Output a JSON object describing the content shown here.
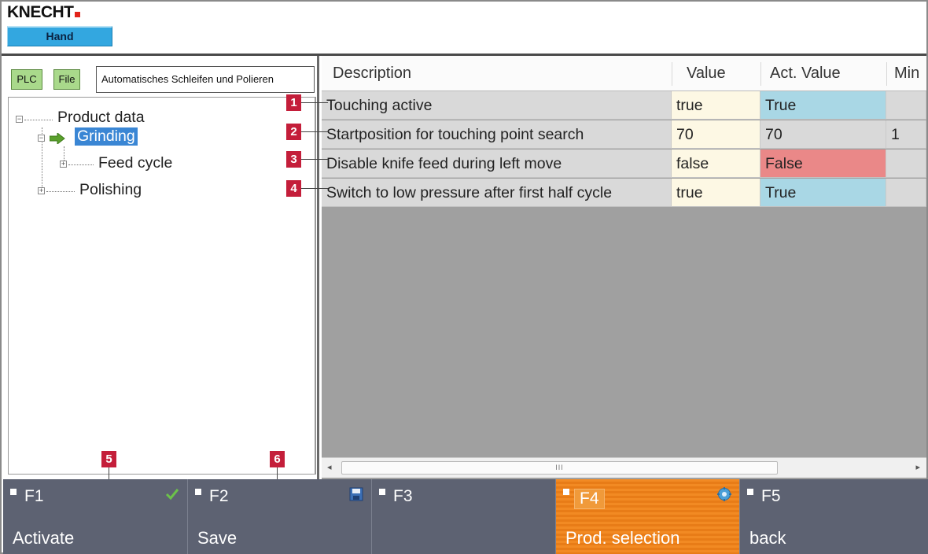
{
  "header": {
    "logo_text": "KNECHT",
    "mode_label": "Hand"
  },
  "left_panel": {
    "plc_label": "PLC",
    "file_label": "File",
    "program_name": "Automatisches Schleifen und Polieren",
    "tree": [
      {
        "label": "Product data",
        "expanded": true,
        "level": 0
      },
      {
        "label": "Grinding",
        "expanded": true,
        "selected": true,
        "level": 1,
        "icon": "arrow-right-icon"
      },
      {
        "label": "Feed cycle",
        "expanded": false,
        "level": 2
      },
      {
        "label": "Polishing",
        "expanded": false,
        "level": 1
      }
    ]
  },
  "grid": {
    "columns": [
      "Description",
      "Value",
      "Act. Value",
      "Min"
    ],
    "rows": [
      {
        "description": "Touching active",
        "value": "true",
        "act_value": "True",
        "min": "",
        "act_color": "#a9d7e5"
      },
      {
        "description": "Startposition for touching point search",
        "value": "70",
        "act_value": "70",
        "min": "1",
        "act_color": "#d9d9d9"
      },
      {
        "description": "Disable knife feed during left move",
        "value": "false",
        "act_value": "False",
        "min": "",
        "act_color": "#ea8888"
      },
      {
        "description": "Switch to low pressure after first half cycle",
        "value": "true",
        "act_value": "True",
        "min": "",
        "act_color": "#a9d7e5"
      }
    ],
    "scroll_thumb_text": "III"
  },
  "callouts": [
    "1",
    "2",
    "3",
    "4",
    "5",
    "6"
  ],
  "function_keys": [
    {
      "key": "F1",
      "label": "Activate",
      "icon": "checkmark-icon",
      "active": false
    },
    {
      "key": "F2",
      "label": "Save",
      "icon": "floppy-disk-icon",
      "active": false
    },
    {
      "key": "F3",
      "label": "",
      "icon": "",
      "active": false
    },
    {
      "key": "F4",
      "label": "Prod. selection",
      "icon": "gear-icon",
      "active": true
    },
    {
      "key": "F5",
      "label": "back",
      "icon": "",
      "active": false
    }
  ],
  "colors": {
    "accent_blue": "#33a7e0",
    "selection_blue": "#3a86d4",
    "active_orange": "#f28a23",
    "callout_red": "#c41e3a",
    "plc_green": "#a9d98b"
  }
}
